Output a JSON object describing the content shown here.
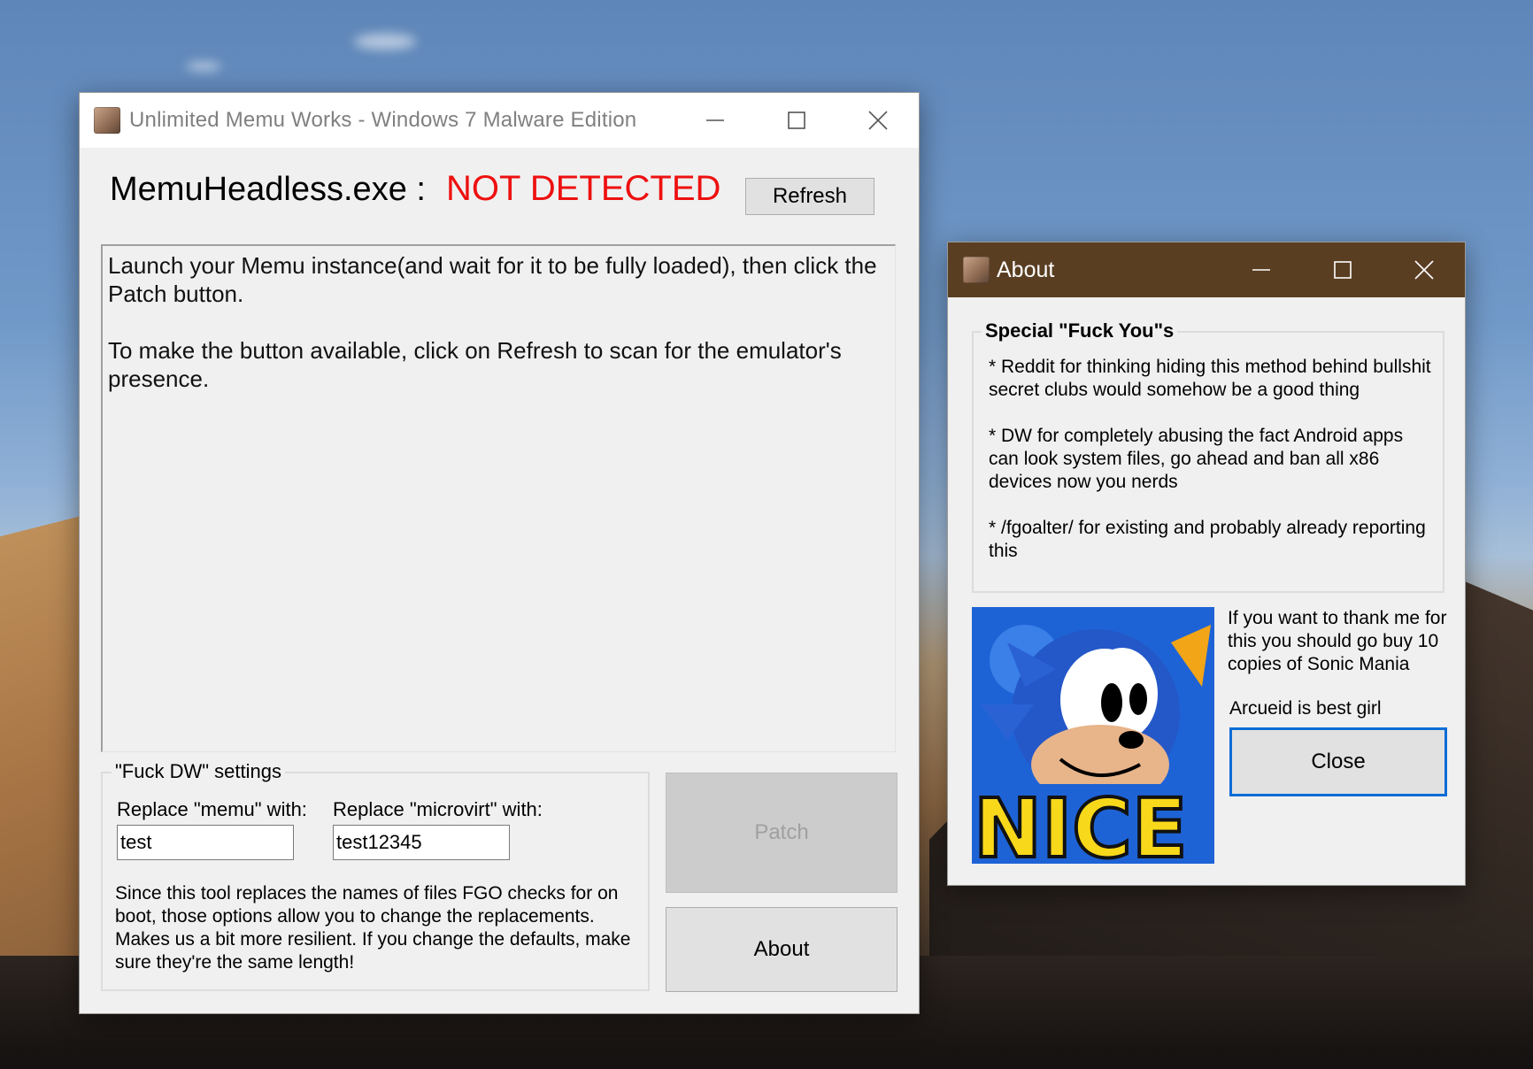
{
  "main_window": {
    "title": "Unlimited Memu Works - Windows 7 Malware Edition",
    "status_label": "MemuHeadless.exe :",
    "status_value": "NOT DETECTED",
    "refresh_button": "Refresh",
    "instructions": "Launch your Memu instance(and wait for it to be fully loaded), then click the Patch button.\n\nTo make the button available, click on Refresh to scan for the emulator's presence.",
    "settings": {
      "legend": "\"Fuck DW\" settings",
      "memu_label": "Replace \"memu\" with:",
      "memu_value": "test",
      "microvirt_label": "Replace \"microvirt\" with:",
      "microvirt_value": "test12345",
      "help_text": "Since this tool replaces the names of files FGO checks for on boot, those options allow you to change the replacements. Makes us a bit more resilient. If you change the defaults, make sure they're the same length!"
    },
    "patch_button": "Patch",
    "about_button": "About"
  },
  "about_window": {
    "title": "About",
    "group_legend": "Special \"Fuck You\"s",
    "group_text": "* Reddit for thinking hiding this method behind bullshit secret clubs would somehow be a good thing\n\n* DW for completely abusing the fact Android apps can look system files, go ahead and ban all x86 devices now you nerds\n\n* /fgoalter/ for existing and probably already reporting this",
    "thanks_text": "If you want to thank me for this you should go buy 10 copies of Sonic Mania",
    "best_girl_text": "Arcueid is best girl",
    "image_caption": "NICE",
    "close_button": "Close"
  },
  "colors": {
    "status_red": "#ee1010",
    "about_titlebar": "#5a3e22",
    "focus_blue": "#0a6cd6"
  }
}
